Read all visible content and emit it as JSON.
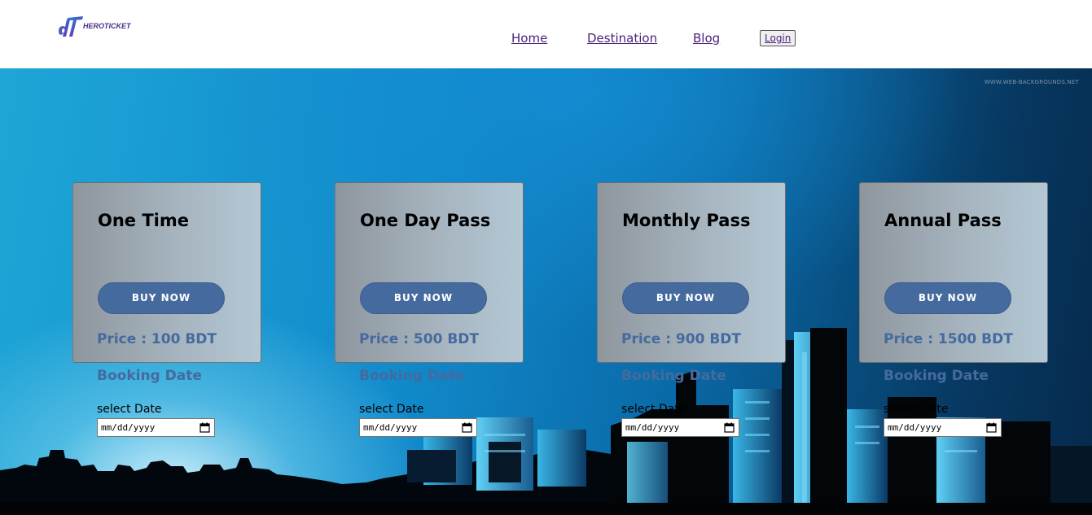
{
  "header": {
    "logo_text": "HEROTICKET",
    "nav": [
      {
        "label": "Home"
      },
      {
        "label": "Destination"
      },
      {
        "label": "Blog"
      }
    ],
    "login_label": "Login"
  },
  "hero": {
    "watermark": "WWW.WEB-BACKGROUNDS.NET"
  },
  "cards": [
    {
      "title": "One Time",
      "buy_label": "BUY NOW",
      "price": "Price : 100 BDT",
      "booking_label": "Booking Date",
      "select_label": "select Date",
      "date_placeholder": "mm/dd/yyyy"
    },
    {
      "title": "One Day Pass",
      "buy_label": "BUY NOW",
      "price": "Price : 500 BDT",
      "booking_label": "Booking Date",
      "select_label": "select Date",
      "date_placeholder": "mm/dd/yyyy"
    },
    {
      "title": "Monthly Pass",
      "buy_label": "BUY NOW",
      "price": "Price : 900 BDT",
      "booking_label": "Booking Date",
      "select_label": "select Date",
      "date_placeholder": "mm/dd/yyyy"
    },
    {
      "title": "Annual Pass",
      "buy_label": "BUY NOW",
      "price": "Price : 1500 BDT",
      "booking_label": "Booking Date",
      "select_label": "select Date",
      "date_placeholder": "mm/dd/yyyy"
    }
  ],
  "colors": {
    "accent": "#456a9e",
    "nav_link": "#4a1f7a"
  }
}
